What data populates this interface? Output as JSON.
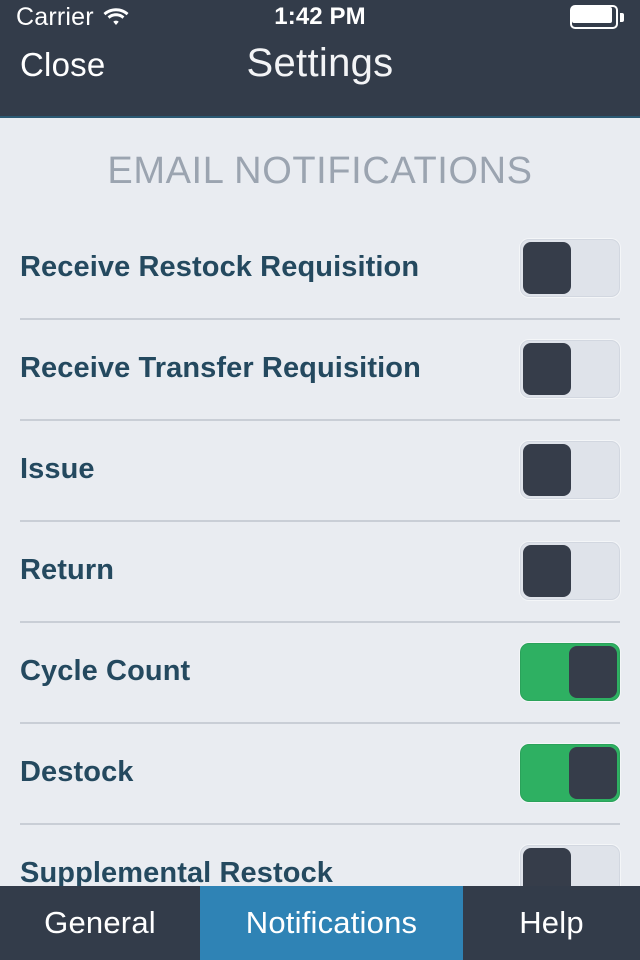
{
  "statusbar": {
    "carrier": "Carrier",
    "time": "1:42 PM",
    "wifi_icon": "wifi-icon",
    "battery_icon": "battery-full-icon"
  },
  "navbar": {
    "close_label": "Close",
    "title": "Settings"
  },
  "section": {
    "header": "EMAIL NOTIFICATIONS"
  },
  "rows": [
    {
      "label": "Receive Restock Requisition",
      "on": false
    },
    {
      "label": "Receive Transfer Requisition",
      "on": false
    },
    {
      "label": "Issue",
      "on": false
    },
    {
      "label": "Return",
      "on": false
    },
    {
      "label": "Cycle Count",
      "on": true
    },
    {
      "label": "Destock",
      "on": true
    },
    {
      "label": "Supplemental Restock",
      "on": false
    }
  ],
  "tabbar": {
    "tabs": [
      {
        "label": "General",
        "active": false
      },
      {
        "label": "Notifications",
        "active": true
      },
      {
        "label": "Help",
        "active": false
      }
    ]
  },
  "colors": {
    "header_bg": "#333c4a",
    "content_bg": "#e9ecf1",
    "label": "#24495f",
    "section_header": "#9ba4b0",
    "toggle_on": "#2eb062",
    "toggle_knob": "#363d4a",
    "toggle_off_track": "#dfe3ea",
    "tab_active": "#2f83b5",
    "separator": "#c9ced6"
  }
}
